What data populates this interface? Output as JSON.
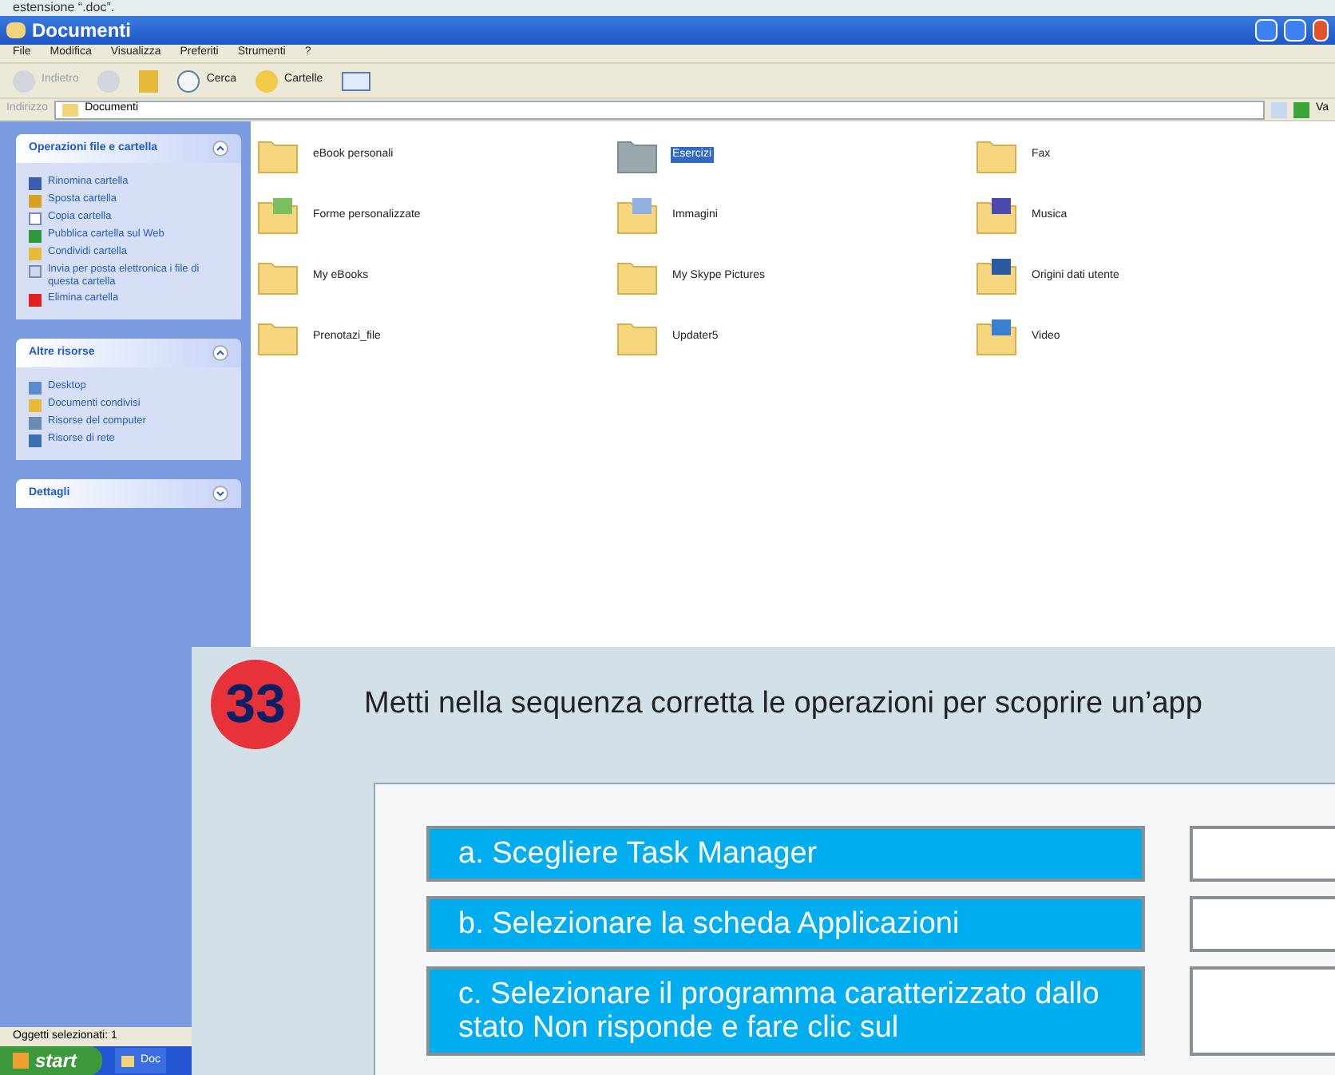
{
  "page_text": "estensione “.doc”.",
  "window": {
    "title": "Documenti",
    "menu": [
      "File",
      "Modifica",
      "Visualizza",
      "Preferiti",
      "Strumenti",
      "?"
    ],
    "toolbar": [
      {
        "label": "Indietro",
        "disabled": true
      },
      {
        "label": "Cerca",
        "disabled": false
      },
      {
        "label": "Cartelle",
        "disabled": false
      }
    ],
    "address": {
      "label": "Indirizzo",
      "value": "Documenti",
      "go": "Va"
    },
    "panels": [
      {
        "title": "Operazioni file e cartella",
        "expanded": true,
        "items": [
          {
            "label": "Rinomina cartella",
            "kind": "rename"
          },
          {
            "label": "Sposta cartella",
            "kind": "move"
          },
          {
            "label": "Copia cartella",
            "kind": "copy"
          },
          {
            "label": "Pubblica cartella sul Web",
            "kind": "web"
          },
          {
            "label": "Condividi cartella",
            "kind": "share"
          },
          {
            "label": "Invia per posta elettronica i file di questa cartella",
            "kind": "mail"
          },
          {
            "label": "Elimina cartella",
            "kind": "delete"
          }
        ]
      },
      {
        "title": "Altre risorse",
        "expanded": true,
        "items": [
          {
            "label": "Desktop",
            "kind": "desktop"
          },
          {
            "label": "Documenti condivisi",
            "kind": "share"
          },
          {
            "label": "Risorse del computer",
            "kind": "computer"
          },
          {
            "label": "Risorse di rete",
            "kind": "network"
          }
        ]
      },
      {
        "title": "Dettagli",
        "expanded": false
      }
    ],
    "folders": [
      {
        "name": "eBook personali",
        "kind": "plain",
        "selected": false
      },
      {
        "name": "Esercizi",
        "kind": "plain",
        "selected": true
      },
      {
        "name": "Fax",
        "kind": "plain",
        "selected": false
      },
      {
        "name": "Forme personalizzate",
        "kind": "forms",
        "selected": false
      },
      {
        "name": "Immagini",
        "kind": "pictures",
        "selected": false
      },
      {
        "name": "Musica",
        "kind": "music",
        "selected": false
      },
      {
        "name": "My eBooks",
        "kind": "plain",
        "selected": false
      },
      {
        "name": "My Skype Pictures",
        "kind": "plain",
        "selected": false
      },
      {
        "name": "Origini dati utente",
        "kind": "datasource",
        "selected": false
      },
      {
        "name": "Prenotazi_file",
        "kind": "plain",
        "selected": false
      },
      {
        "name": "Updater5",
        "kind": "plain",
        "selected": false
      },
      {
        "name": "Video",
        "kind": "video",
        "selected": false
      }
    ],
    "status_bar": "Oggetti selezionati: 1",
    "taskbar": {
      "start": "start",
      "tasks": [
        "Doc"
      ]
    }
  },
  "exercise": {
    "number": "33",
    "instruction": "Metti nella sequenza corretta le operazioni per scoprire un’app",
    "steps": [
      {
        "text": "a. Scegliere Task Manager"
      },
      {
        "text": "b. Selezionare la scheda Applicazioni"
      },
      {
        "text": "c. Selezionare il programma caratterizzato dallo stato Non risponde e fare clic sul"
      }
    ]
  }
}
